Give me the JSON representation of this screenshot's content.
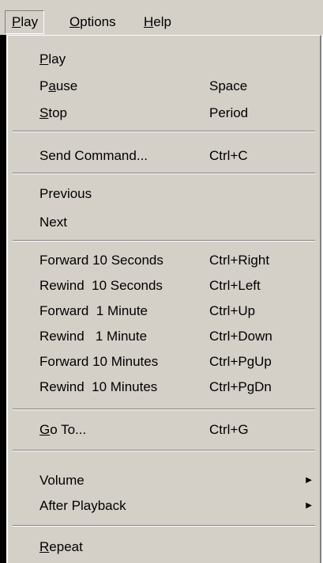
{
  "menubar": {
    "items": [
      {
        "prefix": "",
        "mnemonic": "P",
        "rest": "lay"
      },
      {
        "prefix": "",
        "mnemonic": "O",
        "rest": "ptions"
      },
      {
        "prefix": "",
        "mnemonic": "H",
        "rest": "elp"
      }
    ]
  },
  "menu": {
    "items": [
      {
        "prefix": "",
        "mnemonic": "P",
        "rest": "lay",
        "shortcut": ""
      },
      {
        "prefix": "P",
        "mnemonic": "a",
        "rest": "use",
        "shortcut": "Space"
      },
      {
        "prefix": "",
        "mnemonic": "S",
        "rest": "top",
        "shortcut": "Period"
      },
      {
        "prefix": "Send Command...",
        "mnemonic": "",
        "rest": "",
        "shortcut": "Ctrl+C"
      },
      {
        "prefix": "Previous",
        "mnemonic": "",
        "rest": "",
        "shortcut": ""
      },
      {
        "prefix": "Next",
        "mnemonic": "",
        "rest": "",
        "shortcut": ""
      },
      {
        "prefix": "Forward 10 Seconds",
        "mnemonic": "",
        "rest": "",
        "shortcut": "Ctrl+Right"
      },
      {
        "prefix": "Rewind  10 Seconds",
        "mnemonic": "",
        "rest": "",
        "shortcut": "Ctrl+Left"
      },
      {
        "prefix": "Forward  1 Minute",
        "mnemonic": "",
        "rest": "",
        "shortcut": "Ctrl+Up"
      },
      {
        "prefix": "Rewind   1 Minute",
        "mnemonic": "",
        "rest": "",
        "shortcut": "Ctrl+Down"
      },
      {
        "prefix": "Forward 10 Minutes",
        "mnemonic": "",
        "rest": "",
        "shortcut": "Ctrl+PgUp"
      },
      {
        "prefix": "Rewind  10 Minutes",
        "mnemonic": "",
        "rest": "",
        "shortcut": "Ctrl+PgDn"
      },
      {
        "prefix": "",
        "mnemonic": "G",
        "rest": "o To...",
        "shortcut": "Ctrl+G"
      },
      {
        "prefix": "Volume",
        "mnemonic": "",
        "rest": "",
        "shortcut": ""
      },
      {
        "prefix": "After Playback",
        "mnemonic": "",
        "rest": "",
        "shortcut": ""
      },
      {
        "prefix": "",
        "mnemonic": "R",
        "rest": "epeat",
        "shortcut": ""
      }
    ],
    "submenu_arrow": "▶"
  },
  "colors": {
    "menu_face": "#d4d0c8",
    "highlight": "#ffffff",
    "shadow": "#808080"
  }
}
